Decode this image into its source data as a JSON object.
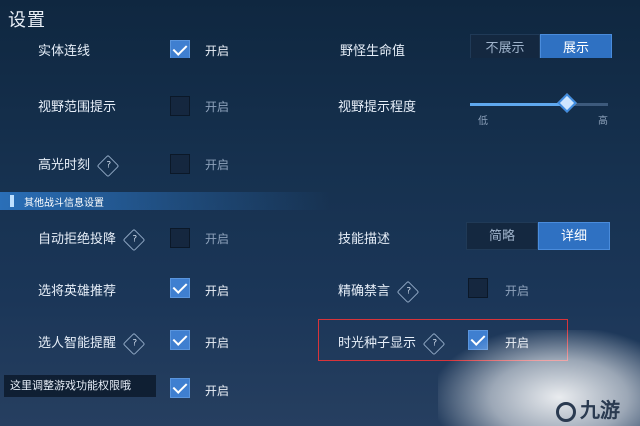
{
  "header": {
    "title": "设置"
  },
  "top_partial": {
    "left_label": "实体连线",
    "left_state": "开启",
    "right_label": "野怪生命值",
    "right_options": [
      "不展示",
      "展示"
    ]
  },
  "left_settings": [
    {
      "label": "视野范围提示",
      "checked": false,
      "state": "开启",
      "hint": false
    },
    {
      "label": "高光时刻",
      "checked": false,
      "state": "开启",
      "hint": true
    }
  ],
  "vision": {
    "label": "视野提示程度",
    "min_label": "低",
    "max_label": "高",
    "level_percent": 70
  },
  "section": {
    "title": "其他战斗信息设置"
  },
  "combat_left": [
    {
      "label": "自动拒绝投降",
      "checked": false,
      "state": "开启",
      "hint": true
    },
    {
      "label": "选将英雄推荐",
      "checked": true,
      "state": "开启",
      "hint": false
    },
    {
      "label": "选人智能提醒",
      "checked": true,
      "state": "开启",
      "hint": true
    },
    {
      "label": "",
      "checked": true,
      "state": "开启",
      "hint": false
    }
  ],
  "skill_desc": {
    "label": "技能描述",
    "options": [
      "简略",
      "详细"
    ],
    "selected": "详细"
  },
  "precise_mute": {
    "label": "精确禁言",
    "checked": false,
    "state": "开启"
  },
  "time_seed": {
    "label": "时光种子显示",
    "checked": true,
    "state": "开启"
  },
  "tooltip": {
    "text": "这里调整游戏功能权限哦"
  },
  "hint_glyph": "?",
  "watermark": {
    "text": "九游"
  },
  "colors": {
    "accent": "#2f71c2",
    "highlight_box": "#d8343a",
    "section": "#2a6fb8"
  }
}
